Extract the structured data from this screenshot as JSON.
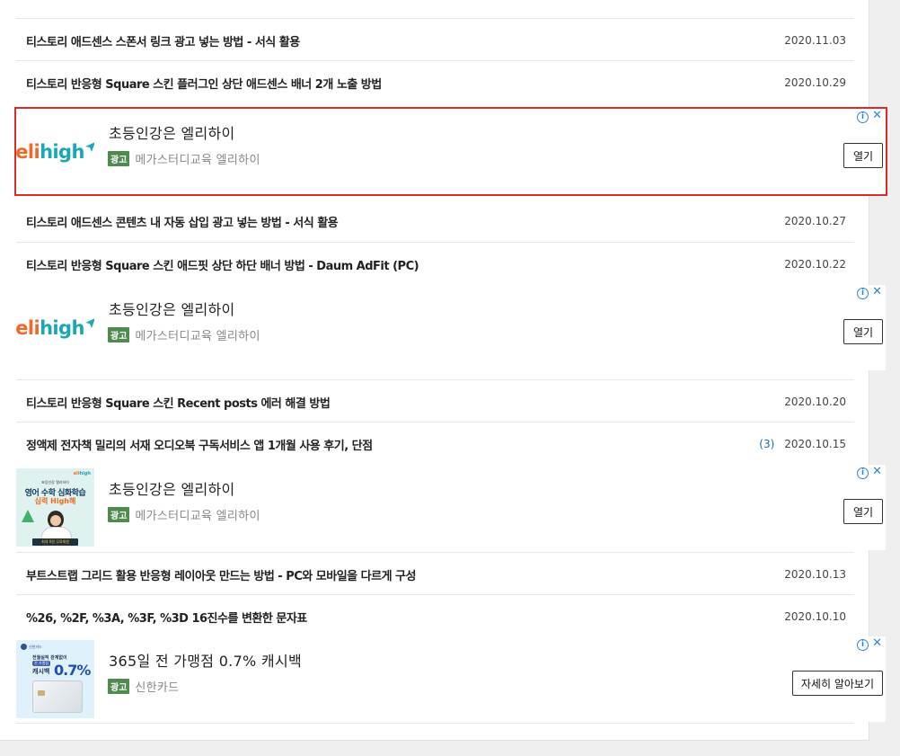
{
  "posts": [
    {
      "title": "티스토리 애드센스 스폰서 링크 광고 넣는 방법 - 서식 활용",
      "date": "2020.11.03",
      "count": ""
    },
    {
      "title": "티스토리 반응형 Square 스킨 플러그인 상단 애드센스 배너 2개 노출 방법",
      "date": "2020.10.29",
      "count": ""
    },
    {
      "title": "티스토리 애드센스 콘텐츠 내 자동 삽입 광고 넣는 방법 - 서식 활용",
      "date": "2020.10.27",
      "count": ""
    },
    {
      "title": "티스토리 반응형 Square 스킨 애드핏 상단 하단 배너 방법 - Daum AdFit (PC)",
      "date": "2020.10.22",
      "count": ""
    },
    {
      "title": "티스토리 반응형 Square 스킨 Recent posts 에러 해결 방법",
      "date": "2020.10.20",
      "count": ""
    },
    {
      "title": "정액제 전자책 밀리의 서재 오디오북 구독서비스 앱 1개월 사용 후기, 단점",
      "date": "2020.10.15",
      "count": "(3)"
    },
    {
      "title": "부트스트랩 그리드 활용 반응형 레이아웃 만드는 방법 - PC와 모바일을 다르게 구성",
      "date": "2020.10.13",
      "count": ""
    },
    {
      "title": "%26, %2F, %3A, %3F, %3D 16진수를 변환한 문자표",
      "date": "2020.10.10",
      "count": ""
    }
  ],
  "ads": [
    {
      "headline": "초등인강은 엘리하이",
      "badge": "광고",
      "advertiser": "메가스터디교육 엘리하이",
      "cta": "열기",
      "info": "i",
      "close": "✕",
      "logo_orange": "eli",
      "logo_teal": "high"
    },
    {
      "headline": "초등인강은 엘리하이",
      "badge": "광고",
      "advertiser": "메가스터디교육 엘리하이",
      "cta": "열기",
      "info": "i",
      "close": "✕",
      "logo_orange": "eli",
      "logo_teal": "high"
    },
    {
      "headline": "초등인강은 엘리하이",
      "badge": "광고",
      "advertiser": "메가스터디교육 엘리하이",
      "cta": "열기",
      "info": "i",
      "close": "✕",
      "creative": {
        "brand_orange": "eli",
        "brand_teal": "high",
        "line1": "초등인강 엘리하이",
        "line2": "영어 수학 심화학습",
        "line3": "심력 High해",
        "bar_text": "최대 0원 무료체험"
      }
    },
    {
      "headline": "365일 전 가맹점 0.7% 캐시백",
      "badge": "광고",
      "advertiser": "신한카드",
      "cta": "자세히 알아보기",
      "info": "i",
      "close": "✕",
      "creative": {
        "brand": "신한카드",
        "line1": "전월실적 관계없이",
        "pill": "전 가맹점",
        "line2": "캐시백",
        "pct": "0.7%"
      }
    }
  ],
  "colors": {
    "highlight_border": "#e02a2a",
    "ad_badge": "#4f8a4f",
    "info_blue": "#2b88d8",
    "comment_count": "#1a6fa8"
  }
}
